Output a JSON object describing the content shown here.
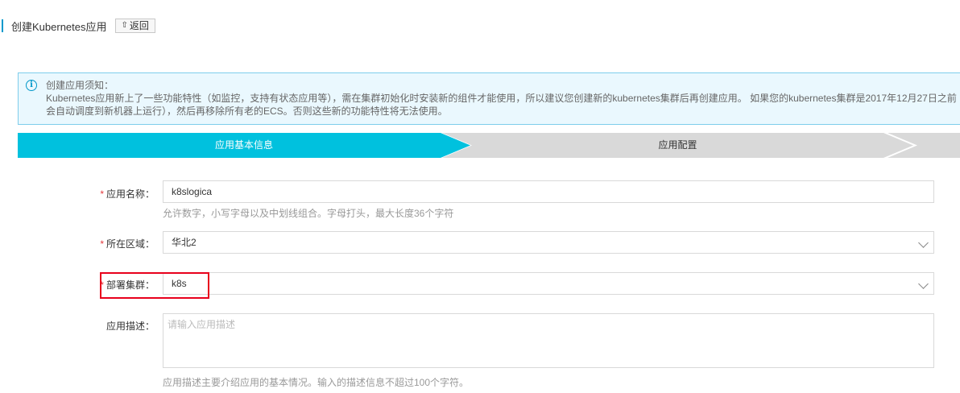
{
  "header": {
    "title": "创建Kubernetes应用",
    "back_label": "返回"
  },
  "notice": {
    "heading": "创建应用须知：",
    "line1": "Kubernetes应用新上了一些功能特性（如监控，支持有状态应用等），需在集群初始化时安装新的组件才能使用，所以建议您创建新的kubernetes集群后再创建应用。 如果您的kubernetes集群是2017年12月27日之前",
    "line2": "会自动调度到新机器上运行），然后再移除所有老的ECS。否则这些新的功能特性将无法使用。"
  },
  "steps": [
    {
      "label": "应用基本信息",
      "active": true
    },
    {
      "label": "应用配置",
      "active": false
    },
    {
      "label": "",
      "active": false
    }
  ],
  "form": {
    "name": {
      "label": "应用名称：",
      "value": "k8slogica",
      "help": "允许数字，小写字母以及中划线组合。字母打头，最大长度36个字符"
    },
    "region": {
      "label": "所在区域：",
      "value": "华北2"
    },
    "cluster": {
      "label": "部署集群：",
      "value": "k8s"
    },
    "description": {
      "label": "应用描述：",
      "placeholder": "请输入应用描述",
      "help": "应用描述主要介绍应用的基本情况。输入的描述信息不超过100个字符。"
    }
  },
  "colors": {
    "accent": "#00c1de",
    "highlight": "#e8001c",
    "required": "#e4393c"
  }
}
